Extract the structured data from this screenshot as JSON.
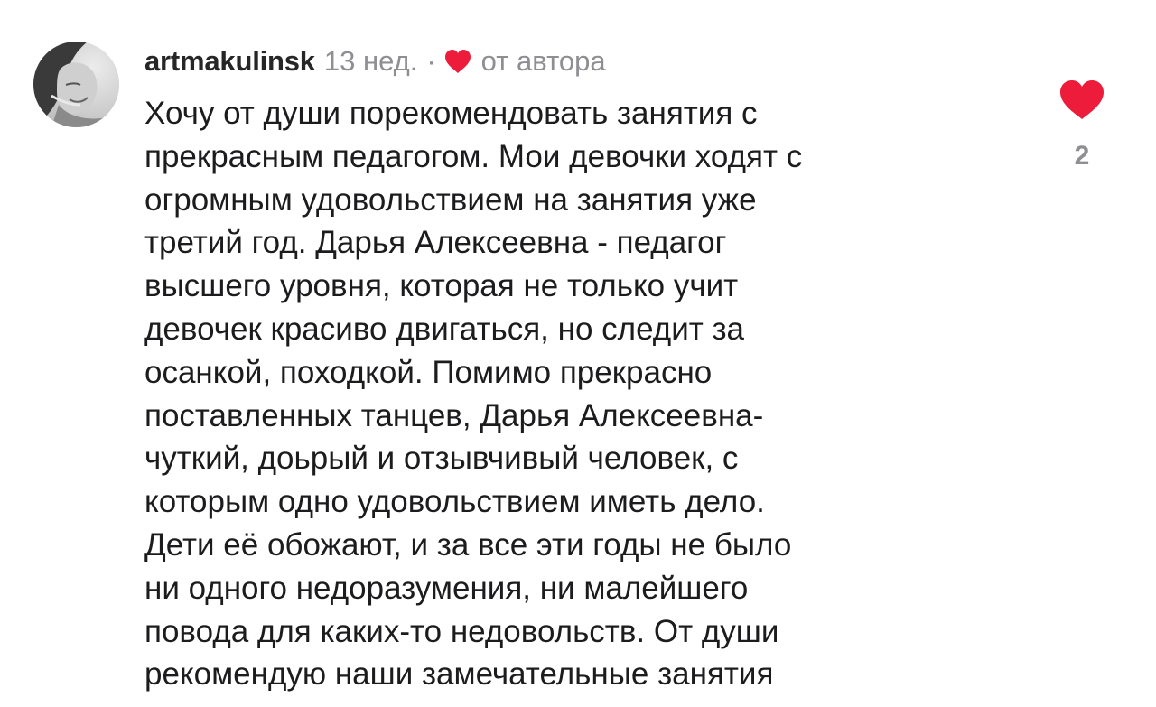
{
  "comment": {
    "username": "artmakulinsk",
    "time": "13 нед.",
    "separator": "·",
    "author_like_label": "от автора",
    "text": "Хочу от души порекомендовать занятия с\nпрекрасным педагогом. Мои девочки  ходят с\nогромным удовольствием на занятия уже\nтретий год. Дарья Алексеевна - педагог\nвысшего уровня, которая не только учит\nдевочек красиво двигаться, но  следит за\nосанкой, походкой. Помимо прекрасно\nпоставленных танцев, Дарья Алексеевна-\nчуткий, доьрый и отзывчивый человек, с\nкоторым одно удовольствием иметь дело.\nДети её обожают, и за все эти годы не было\nни одного недоразумения, ни малейшего\nповода для каких-то недовольств. От души\nрекомендую наши замечательные занятия",
    "like_count": "2",
    "heart_color": "#ed1c3a",
    "muted_color": "#8e8e93",
    "avatar_icon": "user-photo",
    "author_heart_icon": "heart-filled",
    "like_icon": "heart-filled"
  }
}
